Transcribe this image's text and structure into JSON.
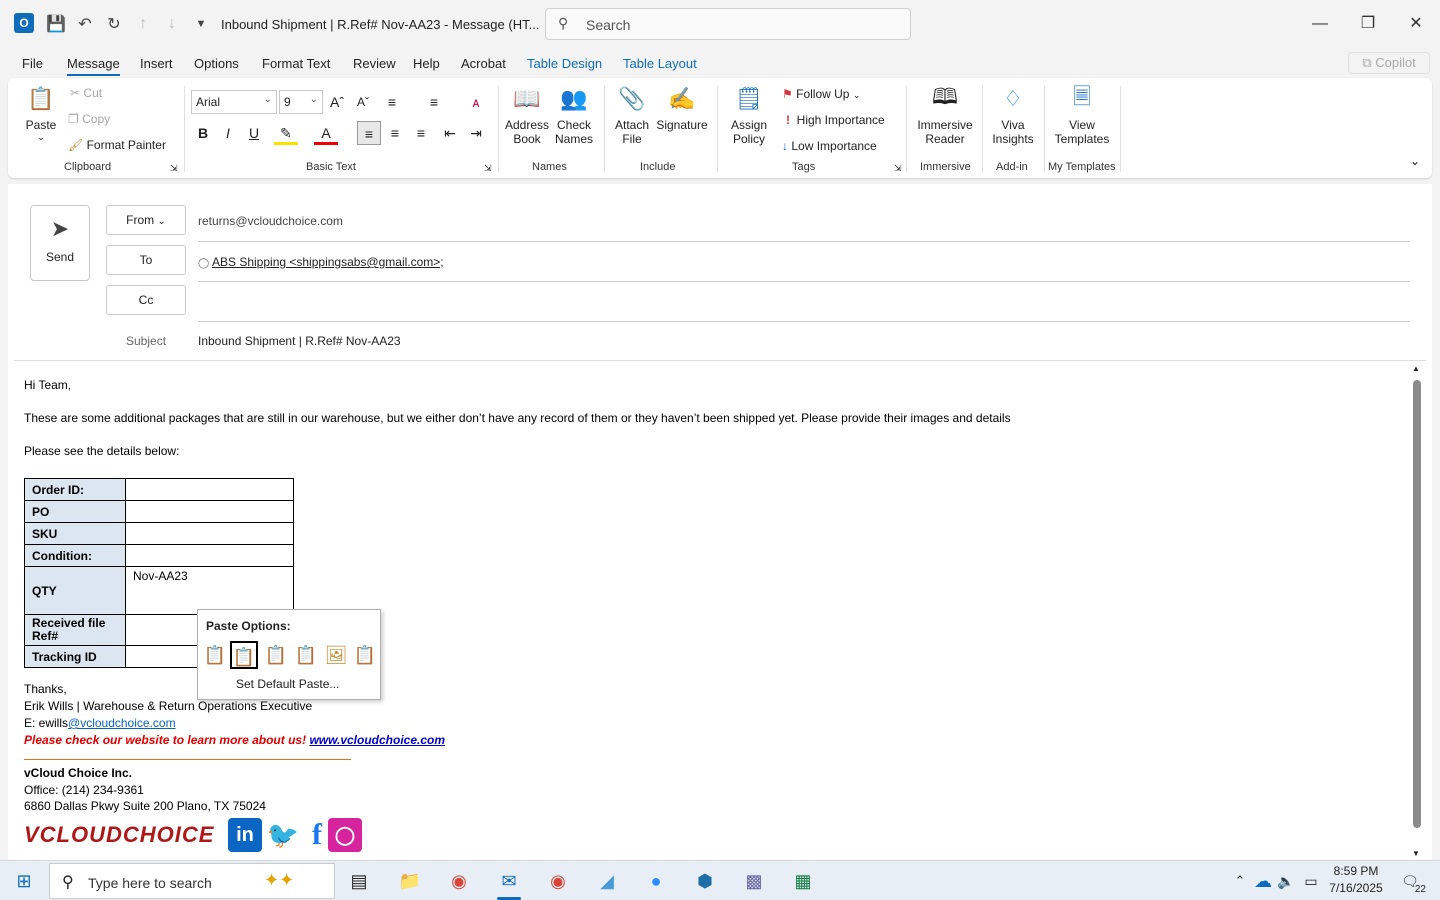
{
  "titlebar": {
    "app_icon": "outlook-icon",
    "title": "Inbound Shipment | R.Ref# Nov-AA23  -  Message (HT...",
    "search_placeholder": "Search"
  },
  "menu": [
    "File",
    "Message",
    "Insert",
    "Options",
    "Format Text",
    "Review",
    "Help",
    "Acrobat",
    "Table Design",
    "Table Layout"
  ],
  "copilot_label": "Copilot",
  "ribbon": {
    "clipboard": {
      "paste": "Paste",
      "cut": "Cut",
      "copy": "Copy",
      "format_painter": "Format Painter",
      "label": "Clipboard"
    },
    "basic_text": {
      "font": "Arial",
      "size": "9",
      "label": "Basic Text"
    },
    "names": {
      "address_book": "Address Book",
      "check_names": "Check Names",
      "label": "Names"
    },
    "include": {
      "attach_file": "Attach File",
      "signature": "Signature",
      "label": "Include"
    },
    "tags": {
      "assign_policy": "Assign Policy",
      "follow_up": "Follow Up",
      "high_importance": "High Importance",
      "low_importance": "Low Importance",
      "label": "Tags"
    },
    "immersive": {
      "reader": "Immersive Reader",
      "label": "Immersive"
    },
    "addin": {
      "viva": "Viva Insights",
      "label": "Add-in"
    },
    "templates": {
      "view": "View Templates",
      "label": "My Templates"
    }
  },
  "compose": {
    "send": "Send",
    "from_btn": "From",
    "from_value": "returns@vcloudchoice.com",
    "to_btn": "To",
    "to_value": "ABS Shipping <shippingsabs@gmail.com>;",
    "cc_btn": "Cc",
    "subject_label": "Subject",
    "subject_value": "Inbound Shipment | R.Ref# Nov-AA23"
  },
  "body": {
    "greeting": "Hi Team,",
    "line1": "These are some additional packages that are still in our warehouse, but we either don’t have any record of them or they haven’t been shipped yet. Please provide their images and details",
    "line2": "Please see the details below:",
    "table": {
      "order_id": "Order ID:",
      "po": "PO",
      "sku": "SKU",
      "condition": "Condition:",
      "qty": "QTY",
      "qty_value": "Nov-AA23",
      "received": "Received file Ref#",
      "tracking": "Tracking ID"
    },
    "thanks": "Thanks,",
    "sig_name": "Erik Wills | Warehouse & Return Operations Executive",
    "sig_email_prefix": "E: ewills",
    "sig_email_link": "@vcloudchoice.com",
    "promo": "Please check our website to learn more about us!",
    "promo_link": "www.vcloudchoice.com",
    "company": "vCloud Choice Inc.",
    "office": "Office: (214) 234-9361",
    "address": "6860 Dallas Pkwy Suite 200 Plano, TX 75024",
    "logo_text": "VCLOUDCHOICE"
  },
  "paste_options": {
    "title": "Paste Options:",
    "default": "Set Default Paste..."
  },
  "taskbar": {
    "search_placeholder": "Type here to search",
    "time": "8:59 PM",
    "date": "7/16/2025",
    "notif_count": "22"
  }
}
